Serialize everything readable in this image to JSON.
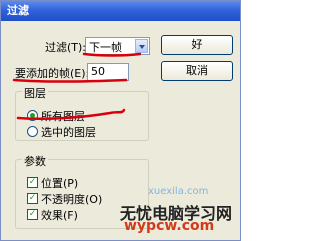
{
  "window": {
    "title": "过滤"
  },
  "filter_row": {
    "label": "过滤(T):",
    "selected": "下一帧"
  },
  "frames_row": {
    "label": "要添加的帧(E):",
    "value": "50"
  },
  "buttons": {
    "ok": "好",
    "cancel": "取消"
  },
  "layers_group": {
    "title": "图层",
    "options": [
      {
        "label": "所有图层",
        "checked": true
      },
      {
        "label": "选中的图层",
        "checked": false
      }
    ]
  },
  "params_group": {
    "title": "参数",
    "items": [
      {
        "label": "位置(P)",
        "checked": true
      },
      {
        "label": "不透明度(O)",
        "checked": true
      },
      {
        "label": "效果(F)",
        "checked": true
      }
    ]
  },
  "watermark": {
    "top_text": "xuexila.com",
    "logo_text": "无忧电脑学习网",
    "url_text": "wypcw.com"
  },
  "colors": {
    "title_bar": "#3263d9",
    "annotation": "#d8000c"
  }
}
